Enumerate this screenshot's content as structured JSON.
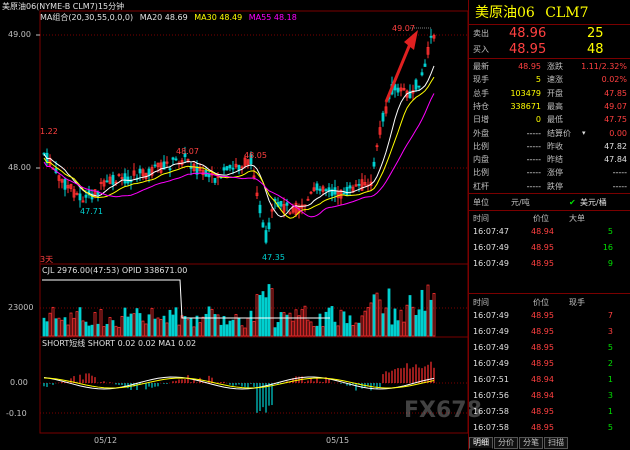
{
  "chart": {
    "title": "美原油06(NYME-B CLM7)15分钟",
    "ma_label": "MA组合(20,30,55,0,0,0)",
    "ma20": "MA20 48.69",
    "ma30": "MA30 48.49",
    "ma55": "MA55 48.18",
    "y_ticks": [
      "49.00",
      "48.00"
    ],
    "annotations": [
      "49.07",
      "48.07",
      "48.05",
      "47.71",
      "47.35",
      "1.22",
      "3天"
    ],
    "vol_label": "CJL  2976.00(47:53)   OPID  338671.00",
    "vol_tick": "23000",
    "macd_label": "SHORT短线  SHORT  0.02   0.02   MA1  0.02",
    "macd_ticks": [
      "0.00",
      "-0.10"
    ],
    "x_ticks": [
      "05/12",
      "05/15"
    ],
    "colors": {
      "up": "#ff3030",
      "down": "#00d0d0",
      "ma20": "#ffffff",
      "ma30": "#ffff00",
      "ma55": "#ff00ff",
      "grid": "#7a0000"
    }
  },
  "panel": {
    "symbol": "美原油06",
    "code": "CLM7",
    "sell": {
      "label": "卖出",
      "price": "48.96",
      "vol": "25"
    },
    "buy": {
      "label": "买入",
      "price": "48.95",
      "vol": "48"
    },
    "quote_rows": [
      {
        "l1": "最新",
        "v1": "48.95",
        "c1": "red",
        "l2": "涨跌",
        "v2": "1.11/2.32%",
        "c2": "red"
      },
      {
        "l1": "现手",
        "v1": "5",
        "c1": "yellow",
        "l2": "速涨",
        "v2": "0.02%",
        "c2": "red"
      },
      {
        "l1": "总手",
        "v1": "103479",
        "c1": "yellow",
        "l2": "开盘",
        "v2": "47.85",
        "c2": "red"
      },
      {
        "l1": "持仓",
        "v1": "338671",
        "c1": "yellow",
        "l2": "最高",
        "v2": "49.07",
        "c2": "red"
      },
      {
        "l1": "日增",
        "v1": "0",
        "c1": "yellow",
        "l2": "最低",
        "v2": "47.75",
        "c2": "red"
      },
      {
        "l1": "外盘",
        "v1": "-----",
        "c1": "white",
        "l2": "结算价",
        "v2": "0.00",
        "c2": "red"
      },
      {
        "l1": "比例",
        "v1": "-----",
        "c1": "white",
        "l2": "昨收",
        "v2": "47.82",
        "c2": "white"
      },
      {
        "l1": "内盘",
        "v1": "-----",
        "c1": "white",
        "l2": "昨结",
        "v2": "47.84",
        "c2": "white"
      },
      {
        "l1": "比例",
        "v1": "-----",
        "c1": "white",
        "l2": "涨停",
        "v2": "-----",
        "c2": "white"
      },
      {
        "l1": "杠杆",
        "v1": "-----",
        "c1": "white",
        "l2": "跌停",
        "v2": "-----",
        "c2": "white"
      }
    ],
    "unit_row": {
      "label": "单位",
      "opt1": "元/吨",
      "opt2": "美元/桶"
    },
    "trades1": {
      "headers": [
        "时间",
        "价位",
        "大单"
      ],
      "rows": [
        {
          "time": "16:07:47",
          "price": "48.94",
          "vol": "5",
          "vc": "green"
        },
        {
          "time": "16:07:49",
          "price": "48.95",
          "vol": "16",
          "vc": "green"
        },
        {
          "time": "16:07:49",
          "price": "48.95",
          "vol": "9",
          "vc": "green"
        }
      ]
    },
    "trades2": {
      "headers": [
        "时间",
        "价位",
        "现手"
      ],
      "rows": [
        {
          "time": "16:07:49",
          "price": "48.95",
          "vol": "7",
          "vc": "red"
        },
        {
          "time": "16:07:49",
          "price": "48.95",
          "vol": "3",
          "vc": "red"
        },
        {
          "time": "16:07:49",
          "price": "48.95",
          "vol": "5",
          "vc": "green"
        },
        {
          "time": "16:07:49",
          "price": "48.95",
          "vol": "2",
          "vc": "green"
        },
        {
          "time": "16:07:51",
          "price": "48.94",
          "vol": "1",
          "vc": "green"
        },
        {
          "time": "16:07:56",
          "price": "48.94",
          "vol": "3",
          "vc": "green"
        },
        {
          "time": "16:07:58",
          "price": "48.95",
          "vol": "1",
          "vc": "green"
        },
        {
          "time": "16:07:58",
          "price": "48.95",
          "vol": "5",
          "vc": "green"
        }
      ]
    },
    "tabs": [
      "明细",
      "分价",
      "分笔",
      "扫描"
    ]
  },
  "watermark": "FX678"
}
